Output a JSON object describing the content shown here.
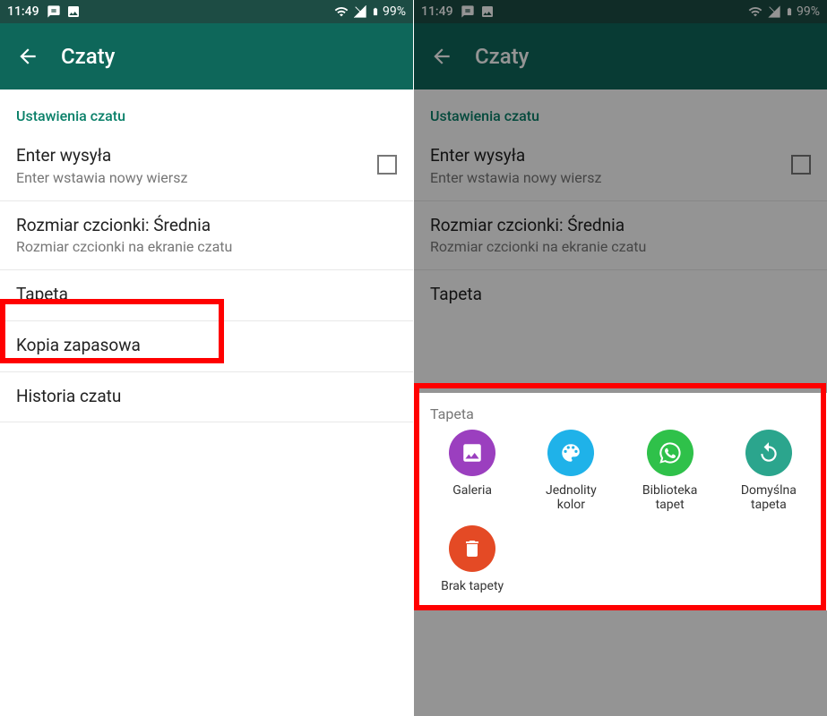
{
  "status_bar": {
    "time": "11:49",
    "battery": "99%"
  },
  "app_bar": {
    "title": "Czaty"
  },
  "section_header": "Ustawienia czatu",
  "settings": {
    "enter": {
      "primary": "Enter wysyła",
      "secondary": "Enter wstawia nowy wiersz"
    },
    "font": {
      "primary": "Rozmiar czcionki: Średnia",
      "secondary": "Rozmiar czcionki na ekranie czatu"
    },
    "wallpaper": {
      "primary": "Tapeta"
    },
    "backup": {
      "primary": "Kopia zapasowa"
    },
    "history": {
      "primary": "Historia czatu"
    }
  },
  "sheet": {
    "title": "Tapeta",
    "items": {
      "gallery": "Galeria",
      "solid": "Jednolity kolor",
      "library": "Biblioteka tapet",
      "default": "Domyślna tapeta",
      "none": "Brak tapety"
    }
  }
}
